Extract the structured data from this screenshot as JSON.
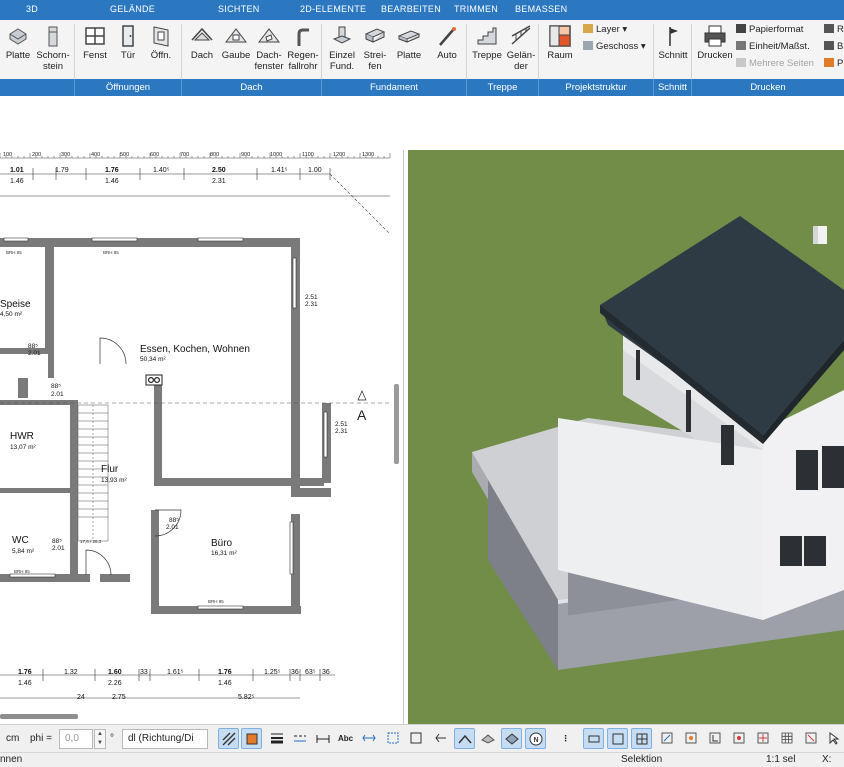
{
  "menu_tabs": [
    "3D",
    "GELÄNDE",
    "SICHTEN",
    "2D-ELEMENTE",
    "BEARBEITEN",
    "TRIMMEN",
    "BEMASSEN"
  ],
  "ribbon": {
    "buttons": {
      "platte": "Platte",
      "schornstein": "Schorn-\nstein",
      "fenster": "Fenst",
      "tuer": "Tür",
      "oeffnung": "Öffn.",
      "dach": "Dach",
      "gaube": "Gaube",
      "dachfenster": "Dach-\nfenster",
      "regenfallrohr": "Regen-\nfallrohr",
      "einzelfundament": "Einzel\nFund.",
      "streifenfundament": "Strei-\nfen",
      "fundamentplatte": "Platte",
      "auto": "Auto",
      "treppe": "Treppe",
      "gelaender": "Gelän-\nder",
      "raum": "Raum",
      "schnitt": "Schnitt",
      "drucken": "Drucken"
    },
    "small": {
      "layer": "Layer ▾",
      "geschoss": "Geschoss ▾",
      "papierformat": "Papierformat",
      "einheit": "Einheit/Maßst.",
      "mehrere_seiten": "Mehrere Seiten",
      "r1": "R",
      "r2": "B",
      "r3": "P"
    },
    "groups": {
      "oeffnungen": "Öffnungen",
      "dach": "Dach",
      "fundament": "Fundament",
      "treppe": "Treppe",
      "projektstruktur": "Projektstruktur",
      "schnitt": "Schnitt",
      "drucken": "Drucken"
    }
  },
  "plan": {
    "ruler_ticks": [
      "100",
      "200",
      "300",
      "400",
      "500",
      "600",
      "700",
      "800",
      "900",
      "1000",
      "1100",
      "1200",
      "1300"
    ],
    "rooms": [
      {
        "name": "Speise",
        "area": "4,50 m²"
      },
      {
        "name": "Essen, Kochen, Wohnen",
        "area": "50,34 m²"
      },
      {
        "name": "HWR",
        "area": "13,07 m²"
      },
      {
        "name": "Flur",
        "area": "13,93 m²"
      },
      {
        "name": "WC",
        "area": "5,84 m²"
      },
      {
        "name": "Büro",
        "area": "16,31 m²"
      }
    ],
    "dims_top_1": [
      "1.01",
      "1.79",
      "1.76",
      "1.40⁵",
      "2.50",
      "1.41⁵",
      "1.00"
    ],
    "dims_top_2": [
      "1.46",
      "1.46",
      "2.31"
    ],
    "dims_bottom_1": [
      "1.76",
      "1.32",
      "1.60",
      "33",
      "1.61⁵",
      "1.76",
      "1.25⁵",
      "36",
      "63⁵",
      "36"
    ],
    "dims_bottom_2": [
      "1.46",
      "2.26",
      "1.46"
    ],
    "dims_bottom_3": [
      "24",
      "2.75",
      "5.82⁵"
    ],
    "openings": [
      "88⁵",
      "2.01",
      "2.51",
      "2.31",
      "1.60",
      "2.50",
      "BRH 85"
    ],
    "section_marker": "A",
    "stair_label": "17,6 / 26,3"
  },
  "toolbar": {
    "unit": "cm",
    "phi_label": "phi =",
    "phi_placeholder": "0,0",
    "degree": "°",
    "direction": "dl (Richtung/Di"
  },
  "status": {
    "left": "nnen",
    "mode": "Selektion",
    "scale": "1:1 sel",
    "x_label": "X:"
  },
  "colors": {
    "accent": "#2c78c0",
    "grass": "#6e8a44",
    "roof": "#2f3a42",
    "wall": "#e9eaec",
    "garage": "#9fa2aa"
  }
}
